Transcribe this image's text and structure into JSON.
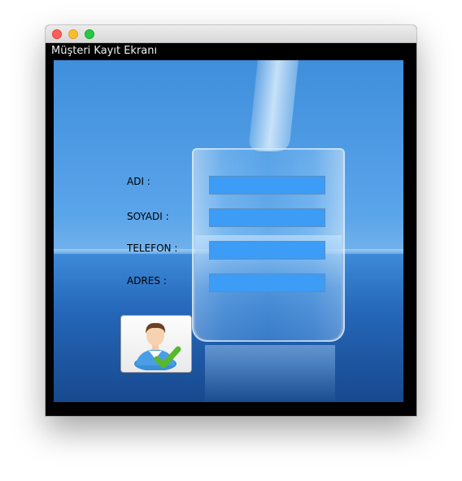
{
  "window": {
    "title": "Müşteri Kayıt Ekranı"
  },
  "form": {
    "fields": [
      {
        "label": "ADI :",
        "value": ""
      },
      {
        "label": "SOYADI :",
        "value": ""
      },
      {
        "label": "TELEFON :",
        "value": ""
      },
      {
        "label": "ADRES :",
        "value": ""
      }
    ],
    "save_button_icon": "user-check-icon"
  },
  "colors": {
    "field_background": "#3d9cf5",
    "frame": "#000000"
  }
}
